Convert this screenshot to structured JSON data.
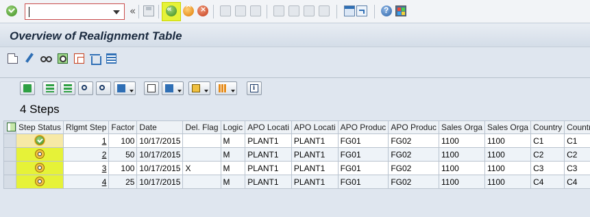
{
  "system_toolbar": {
    "command_field": {
      "value": "",
      "placeholder": ""
    },
    "collapse_glyph": "«",
    "icons": [
      "enter-icon",
      "save-icon",
      "back-icon",
      "exit-icon",
      "cancel-icon",
      "print-icon",
      "find-icon",
      "find-next-icon",
      "first-page-icon",
      "previous-page-icon",
      "next-page-icon",
      "last-page-icon",
      "create-session-icon",
      "shortcut-icon",
      "help-icon",
      "customize-layout-icon"
    ],
    "back_glyph": "«",
    "exit_glyph": "^",
    "cancel_glyph": "×",
    "help_glyph": "?"
  },
  "title_bar": {
    "title": "Overview of Realignment Table"
  },
  "app_toolbar": {
    "icons": [
      "create-icon",
      "change-icon",
      "display-icon",
      "detail-icon",
      "copy-icon",
      "delete-icon",
      "hierarchy-icon"
    ]
  },
  "grid": {
    "title": "4  Steps",
    "toolbar_icons": [
      "details-icon",
      "sort-ascending-icon",
      "sort-descending-icon",
      "find-icon",
      "find-next-icon",
      "filter-icon",
      "print-preview-icon",
      "views-icon",
      "export-icon",
      "layout-icon",
      "information-icon"
    ],
    "columns": [
      "Step Status",
      "Rlgmt Step",
      "Factor",
      "Date",
      "Del. Flag",
      "Logic",
      "APO Locati",
      "APO Locati",
      "APO Produc",
      "APO Produc",
      "Sales Orga",
      "Sales Orga",
      "Country",
      "Country"
    ],
    "rows": [
      {
        "status": "done",
        "step": "1",
        "factor": "100",
        "date": "10/17/2015",
        "del_flag": "",
        "logic": "M",
        "apo_loc_from": "PLANT1",
        "apo_loc_to": "PLANT1",
        "apo_prod_from": "FG01",
        "apo_prod_to": "FG02",
        "sales_org_from": "1100",
        "sales_org_to": "1100",
        "country_from": "C1",
        "country_to": "C1"
      },
      {
        "status": "pending",
        "step": "2",
        "factor": "50",
        "date": "10/17/2015",
        "del_flag": "",
        "logic": "M",
        "apo_loc_from": "PLANT1",
        "apo_loc_to": "PLANT1",
        "apo_prod_from": "FG01",
        "apo_prod_to": "FG02",
        "sales_org_from": "1100",
        "sales_org_to": "1100",
        "country_from": "C2",
        "country_to": "C2"
      },
      {
        "status": "pending",
        "step": "3",
        "factor": "100",
        "date": "10/17/2015",
        "del_flag": "X",
        "logic": "M",
        "apo_loc_from": "PLANT1",
        "apo_loc_to": "PLANT1",
        "apo_prod_from": "FG01",
        "apo_prod_to": "FG02",
        "sales_org_from": "1100",
        "sales_org_to": "1100",
        "country_from": "C3",
        "country_to": "C3"
      },
      {
        "status": "pending",
        "step": "4",
        "factor": "25",
        "date": "10/17/2015",
        "del_flag": "",
        "logic": "M",
        "apo_loc_from": "PLANT1",
        "apo_loc_to": "PLANT1",
        "apo_prod_from": "FG01",
        "apo_prod_to": "FG02",
        "sales_org_from": "1100",
        "sales_org_to": "1100",
        "country_from": "C4",
        "country_to": "C4"
      }
    ]
  },
  "colors": {
    "highlight": "#e6f238",
    "window_bg": "#dfe6ef",
    "title_text": "#1a2a3f"
  }
}
